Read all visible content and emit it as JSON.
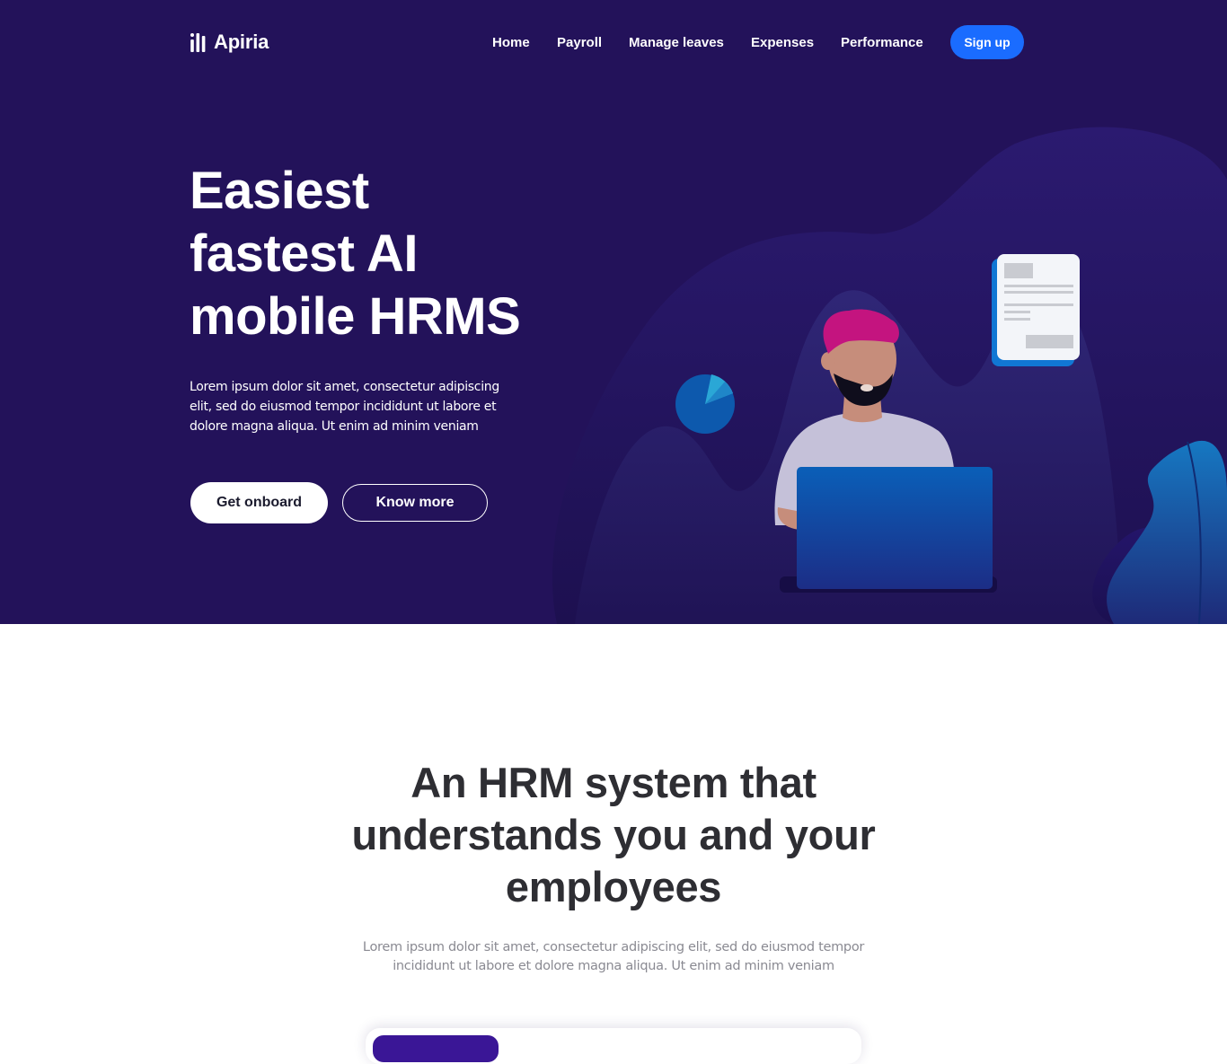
{
  "brand": {
    "name": "Apiria",
    "logo_icon": "bar-logo-icon"
  },
  "nav": {
    "items": [
      {
        "label": "Home"
      },
      {
        "label": "Payroll"
      },
      {
        "label": "Manage leaves"
      },
      {
        "label": "Expenses"
      },
      {
        "label": "Performance"
      }
    ],
    "signup_label": "Sign up"
  },
  "hero": {
    "title_lines": [
      "Easiest",
      "fastest AI",
      "mobile HRMS"
    ],
    "subtitle": "Lorem ipsum dolor sit amet, consectetur adipiscing elit, sed do eiusmod tempor incididunt ut labore et dolore magna aliqua. Ut enim ad minim veniam",
    "primary_button": "Get onboard",
    "secondary_button": "Know more"
  },
  "section": {
    "title_lines": [
      "An HRM system that",
      "understands you and your",
      "employees"
    ],
    "subtitle": "Lorem ipsum dolor sit amet, consectetur adipiscing elit, sed do eiusmod tempor incididunt ut labore et dolore magna aliqua. Ut enim ad minim veniam"
  },
  "colors": {
    "hero_bg": "#23125a",
    "accent_blue": "#1a6cff",
    "heading_dark": "#2e2e33",
    "hair_pink": "#c4147f"
  }
}
